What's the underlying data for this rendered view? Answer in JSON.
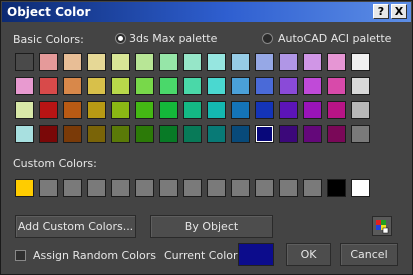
{
  "window": {
    "title": "Object Color",
    "help_label": "?",
    "close_label": "X"
  },
  "basic": {
    "label": "Basic Colors:",
    "palette_max": "3ds Max palette",
    "palette_acad": "AutoCAD ACI palette",
    "rows": [
      [
        "#4a4a4a",
        "#e59a9a",
        "#e8be96",
        "#e6d896",
        "#d8e696",
        "#b8e696",
        "#96e6a8",
        "#96e6c8",
        "#96e6e0",
        "#96cce6",
        "#96a8e6",
        "#b096e6",
        "#d096e6",
        "#e696d4",
        "#f0f0f0"
      ],
      [
        "#e89ad0",
        "#d84a4a",
        "#d8884a",
        "#d8c04a",
        "#b8d84a",
        "#78d84a",
        "#4ad86a",
        "#4ad8a8",
        "#4ad8d0",
        "#4aa0d8",
        "#4a6ad8",
        "#8a4ad8",
        "#c04ad8",
        "#d84aaa",
        "#d8d8d8"
      ],
      [
        "#d8e8a8",
        "#b81414",
        "#b85a14",
        "#b89a14",
        "#8ab814",
        "#44b814",
        "#14b83a",
        "#14b884",
        "#14b8b0",
        "#1474b8",
        "#1434b8",
        "#5c14b8",
        "#9a14b8",
        "#b81486",
        "#b8b8b8"
      ],
      [
        "#a8e0e0",
        "#7a0808",
        "#7a3a08",
        "#7a6408",
        "#5a7a08",
        "#2c7a08",
        "#087a26",
        "#087a58",
        "#087a76",
        "#084a7a",
        "#08087a",
        "#3c087a",
        "#64087a",
        "#7a0858",
        "#7a7a7a"
      ]
    ],
    "selected": [
      3,
      10
    ]
  },
  "custom": {
    "label": "Custom Colors:",
    "colors": [
      "#ffcc00",
      "#7a7a7a",
      "#7a7a7a",
      "#7a7a7a",
      "#7a7a7a",
      "#7a7a7a",
      "#7a7a7a",
      "#7a7a7a",
      "#7a7a7a",
      "#7a7a7a",
      "#7a7a7a",
      "#7a7a7a",
      "#7a7a7a",
      "#000000",
      "#ffffff"
    ]
  },
  "buttons": {
    "add_custom": "Add Custom Colors...",
    "by_object": "By Object",
    "ok": "OK",
    "cancel": "Cancel"
  },
  "assign_random": {
    "label": "Assign Random Colors",
    "checked": false
  },
  "current_color": {
    "label": "Current Color:",
    "value": "#0c0c8c"
  },
  "icons": {
    "picker": "color-picker-icon"
  }
}
